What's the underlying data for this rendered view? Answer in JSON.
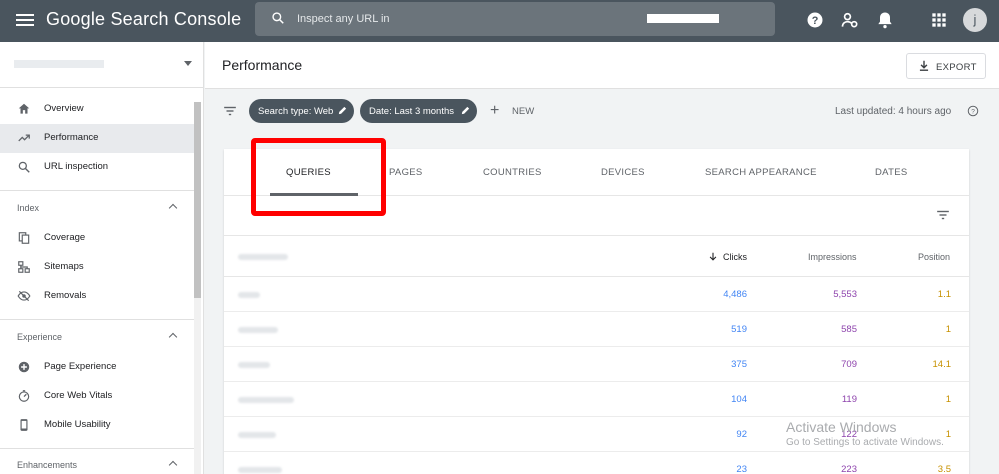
{
  "topbar": {
    "logo": "Google Search Console",
    "search_placeholder": "Inspect any URL in",
    "avatar_letter": "j"
  },
  "sidebar": {
    "nav": [
      {
        "label": "Overview",
        "icon": "home-icon"
      },
      {
        "label": "Performance",
        "icon": "trending-up-icon",
        "active": true
      },
      {
        "label": "URL inspection",
        "icon": "search-icon"
      }
    ],
    "sections": [
      {
        "title": "Index",
        "items": [
          {
            "label": "Coverage",
            "icon": "file-copy-icon"
          },
          {
            "label": "Sitemaps",
            "icon": "sitemap-icon"
          },
          {
            "label": "Removals",
            "icon": "eye-off-icon"
          }
        ]
      },
      {
        "title": "Experience",
        "items": [
          {
            "label": "Page Experience",
            "icon": "add-circle-icon"
          },
          {
            "label": "Core Web Vitals",
            "icon": "speedometer-icon"
          },
          {
            "label": "Mobile Usability",
            "icon": "smartphone-icon"
          }
        ]
      },
      {
        "title": "Enhancements",
        "items": []
      }
    ]
  },
  "header": {
    "title": "Performance",
    "export_label": "EXPORT"
  },
  "filters": {
    "chips": [
      "Search type: Web",
      "Date: Last 3 months"
    ],
    "new_label": "NEW",
    "last_updated": "Last updated: 4 hours ago"
  },
  "tabs": [
    "QUERIES",
    "PAGES",
    "COUNTRIES",
    "DEVICES",
    "SEARCH APPEARANCE",
    "DATES"
  ],
  "table": {
    "columns": {
      "clicks": "Clicks",
      "impressions": "Impressions",
      "position": "Position"
    },
    "rows": [
      {
        "clicks": "4,486",
        "impressions": "5,553",
        "position": "1.1"
      },
      {
        "clicks": "519",
        "impressions": "585",
        "position": "1"
      },
      {
        "clicks": "375",
        "impressions": "709",
        "position": "14.1"
      },
      {
        "clicks": "104",
        "impressions": "119",
        "position": "1"
      },
      {
        "clicks": "92",
        "impressions": "122",
        "position": "1"
      },
      {
        "clicks": "23",
        "impressions": "223",
        "position": "3.5"
      }
    ]
  },
  "watermark": {
    "line1": "Activate Windows",
    "line2": "Go to Settings to activate Windows."
  },
  "colors": {
    "topbar": "#4a555e",
    "clicks": "#4285f4",
    "impressions": "#8e44ad",
    "position": "#c79100",
    "highlight": "#ff0000"
  }
}
